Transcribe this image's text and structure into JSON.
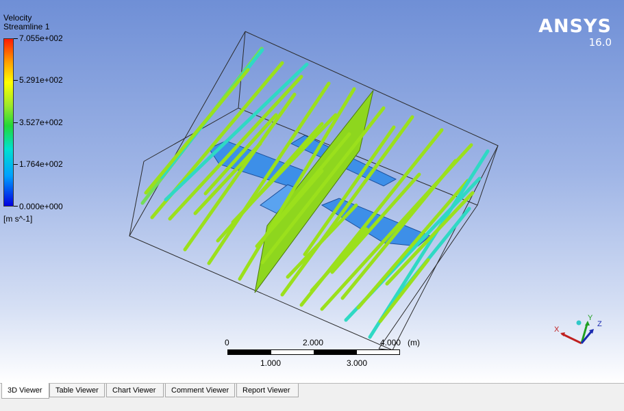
{
  "legend": {
    "title_line1": "Velocity",
    "title_line2": "Streamline 1",
    "labels": [
      "7.055e+002",
      "5.291e+002",
      "3.527e+002",
      "1.764e+002",
      "0.000e+000"
    ],
    "unit": "[m s^-1]"
  },
  "brand": {
    "name": "ANSYS",
    "version": "16.0"
  },
  "scale": {
    "top_labels": [
      "0",
      "2.000",
      "4.000"
    ],
    "unit": "(m)",
    "bottom_labels": [
      "1.000",
      "3.000"
    ]
  },
  "axes": {
    "x": "X",
    "y": "Y",
    "z": "Z"
  },
  "tabs": [
    {
      "label": "3D Viewer",
      "active": true
    },
    {
      "label": "Table Viewer",
      "active": false
    },
    {
      "label": "Chart Viewer",
      "active": false
    },
    {
      "label": "Comment Viewer",
      "active": false
    },
    {
      "label": "Report Viewer",
      "active": false
    }
  ],
  "colors": {
    "streamline_main": "#9be01c",
    "streamline_cyan": "#2fd9c4",
    "wing": "#3d8fe8",
    "background_top": "#6f8fd6"
  }
}
